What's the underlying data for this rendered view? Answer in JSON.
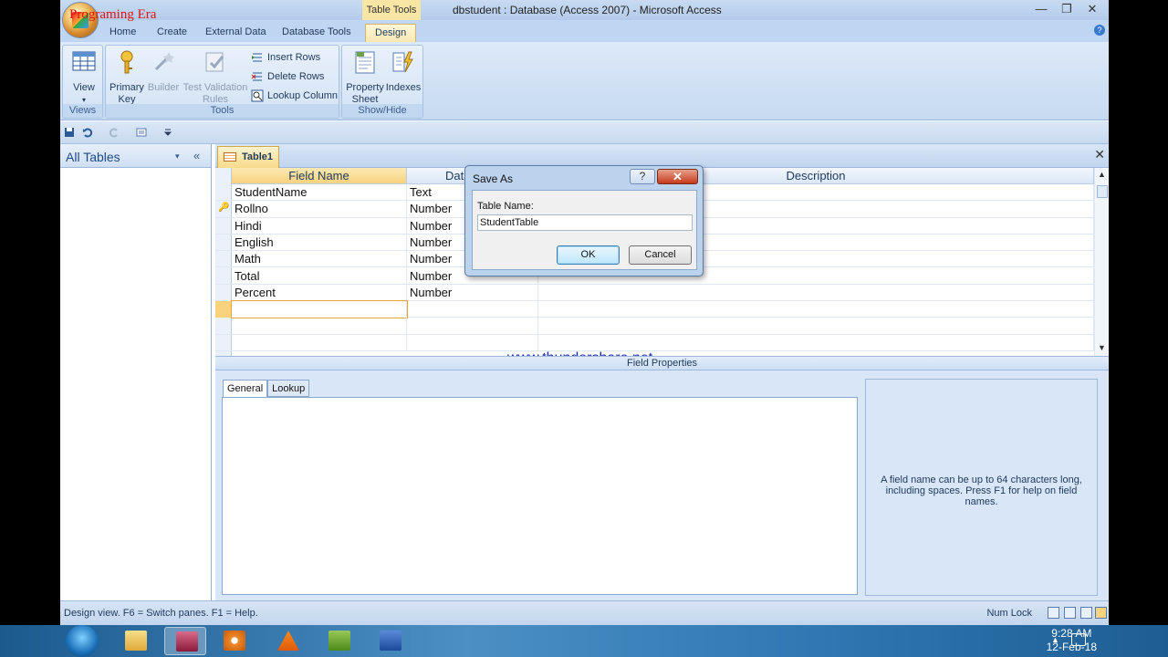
{
  "watermark_top": "Programing Era",
  "title": {
    "context_tab": "Table Tools",
    "window_title": "dbstudent : Database (Access 2007) - Microsoft Access",
    "minimize": "—",
    "maximize": "❐",
    "close": "✕"
  },
  "ribbon_tabs": [
    "Home",
    "Create",
    "External Data",
    "Database Tools",
    "Design"
  ],
  "ribbon": {
    "views": {
      "label": "Views",
      "view_btn": "View",
      "view_arrow": "▾"
    },
    "tools": {
      "label": "Tools",
      "primary_key": [
        "Primary",
        "Key"
      ],
      "builder": "Builder",
      "test_validation": [
        "Test Validation",
        "Rules"
      ],
      "insert_rows": "Insert Rows",
      "delete_rows": "Delete Rows",
      "lookup_column": "Lookup Column"
    },
    "showhide": {
      "label": "Show/Hide",
      "property_sheet": [
        "Property",
        "Sheet"
      ],
      "indexes": "Indexes"
    }
  },
  "nav": {
    "title": "All Tables",
    "dropdown": "▾",
    "collapse": "«"
  },
  "doc_tab": {
    "label": "Table1",
    "close": "✕"
  },
  "grid": {
    "headers": {
      "field_name": "Field Name",
      "data_type": "Data Type",
      "description": "Description"
    },
    "rows": [
      {
        "name": "StudentName",
        "type": "Text",
        "key": false
      },
      {
        "name": "Rollno",
        "type": "Number",
        "key": true
      },
      {
        "name": "Hindi",
        "type": "Number",
        "key": false
      },
      {
        "name": "English",
        "type": "Number",
        "key": false
      },
      {
        "name": "Math",
        "type": "Number",
        "key": false
      },
      {
        "name": "Total",
        "type": "Number",
        "key": false
      },
      {
        "name": "Percent",
        "type": "Number",
        "key": false
      }
    ]
  },
  "watermark_url": "www.thundershare.net",
  "field_properties": {
    "bar_label": "Field Properties",
    "tab_general": "General",
    "tab_lookup": "Lookup",
    "help_text": "A field name can be up to 64 characters long, including spaces.  Press F1 for help on field names."
  },
  "status": {
    "left": "Design view.  F6 = Switch panes.  F1 = Help.",
    "right": "Num Lock"
  },
  "dialog": {
    "title": "Save As",
    "help": "?",
    "close": "✕",
    "label": "Table Name:",
    "value": "StudentTable",
    "ok": "OK",
    "cancel": "Cancel"
  },
  "taskbar": {
    "time": "9:28 AM",
    "date": "12-Feb-18",
    "tray_arrow": "▲"
  },
  "colors": {
    "accent": "#f8d27d",
    "title_bar": "#c9dbf2",
    "taskbar": "#2f78b3"
  }
}
